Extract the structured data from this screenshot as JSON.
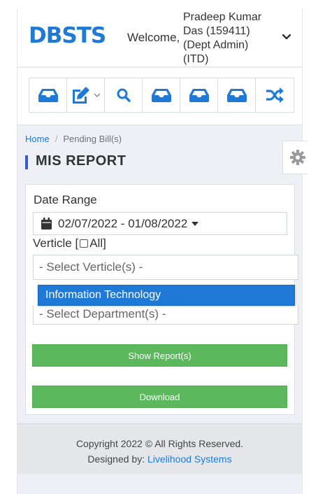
{
  "header": {
    "logo": "DBSTS",
    "welcome": "Welcome,",
    "user_lines": [
      "Pradeep Kumar",
      "Das (159411)",
      "(Dept Admin)",
      "(ITD)"
    ]
  },
  "toolbar": {
    "items": [
      {
        "icon": "inbox-icon"
      },
      {
        "icon": "edit-icon"
      },
      {
        "icon": "search-icon"
      },
      {
        "icon": "inbox-icon"
      },
      {
        "icon": "inbox-icon"
      },
      {
        "icon": "inbox-icon"
      },
      {
        "icon": "shuffle-icon"
      }
    ]
  },
  "breadcrumb": {
    "home": "Home",
    "separator": "/",
    "current": "Pending Bill(s)"
  },
  "page": {
    "title": "MIS REPORT"
  },
  "form": {
    "date_label": "Date Range",
    "date_value": "02/07/2022 - 01/08/2022",
    "verticle_label_prefix": "Verticle [",
    "verticle_label_suffix": " All]",
    "verticle_placeholder": "- Select Verticle(s) -",
    "verticle_option_highlighted": "Information Technology",
    "department_placeholder": "- Select Department(s) -",
    "show_button": "Show Report(s)",
    "download_button": "Download"
  },
  "footer": {
    "copyright": "Copyright 2022 © All Rights Reserved.",
    "designed_by": "Designed by:",
    "company": "Livelihood Systems"
  },
  "colors": {
    "brand": "#1e7ad6",
    "button_green": "#5cb85c",
    "accent_bar": "#3b5bc8"
  }
}
